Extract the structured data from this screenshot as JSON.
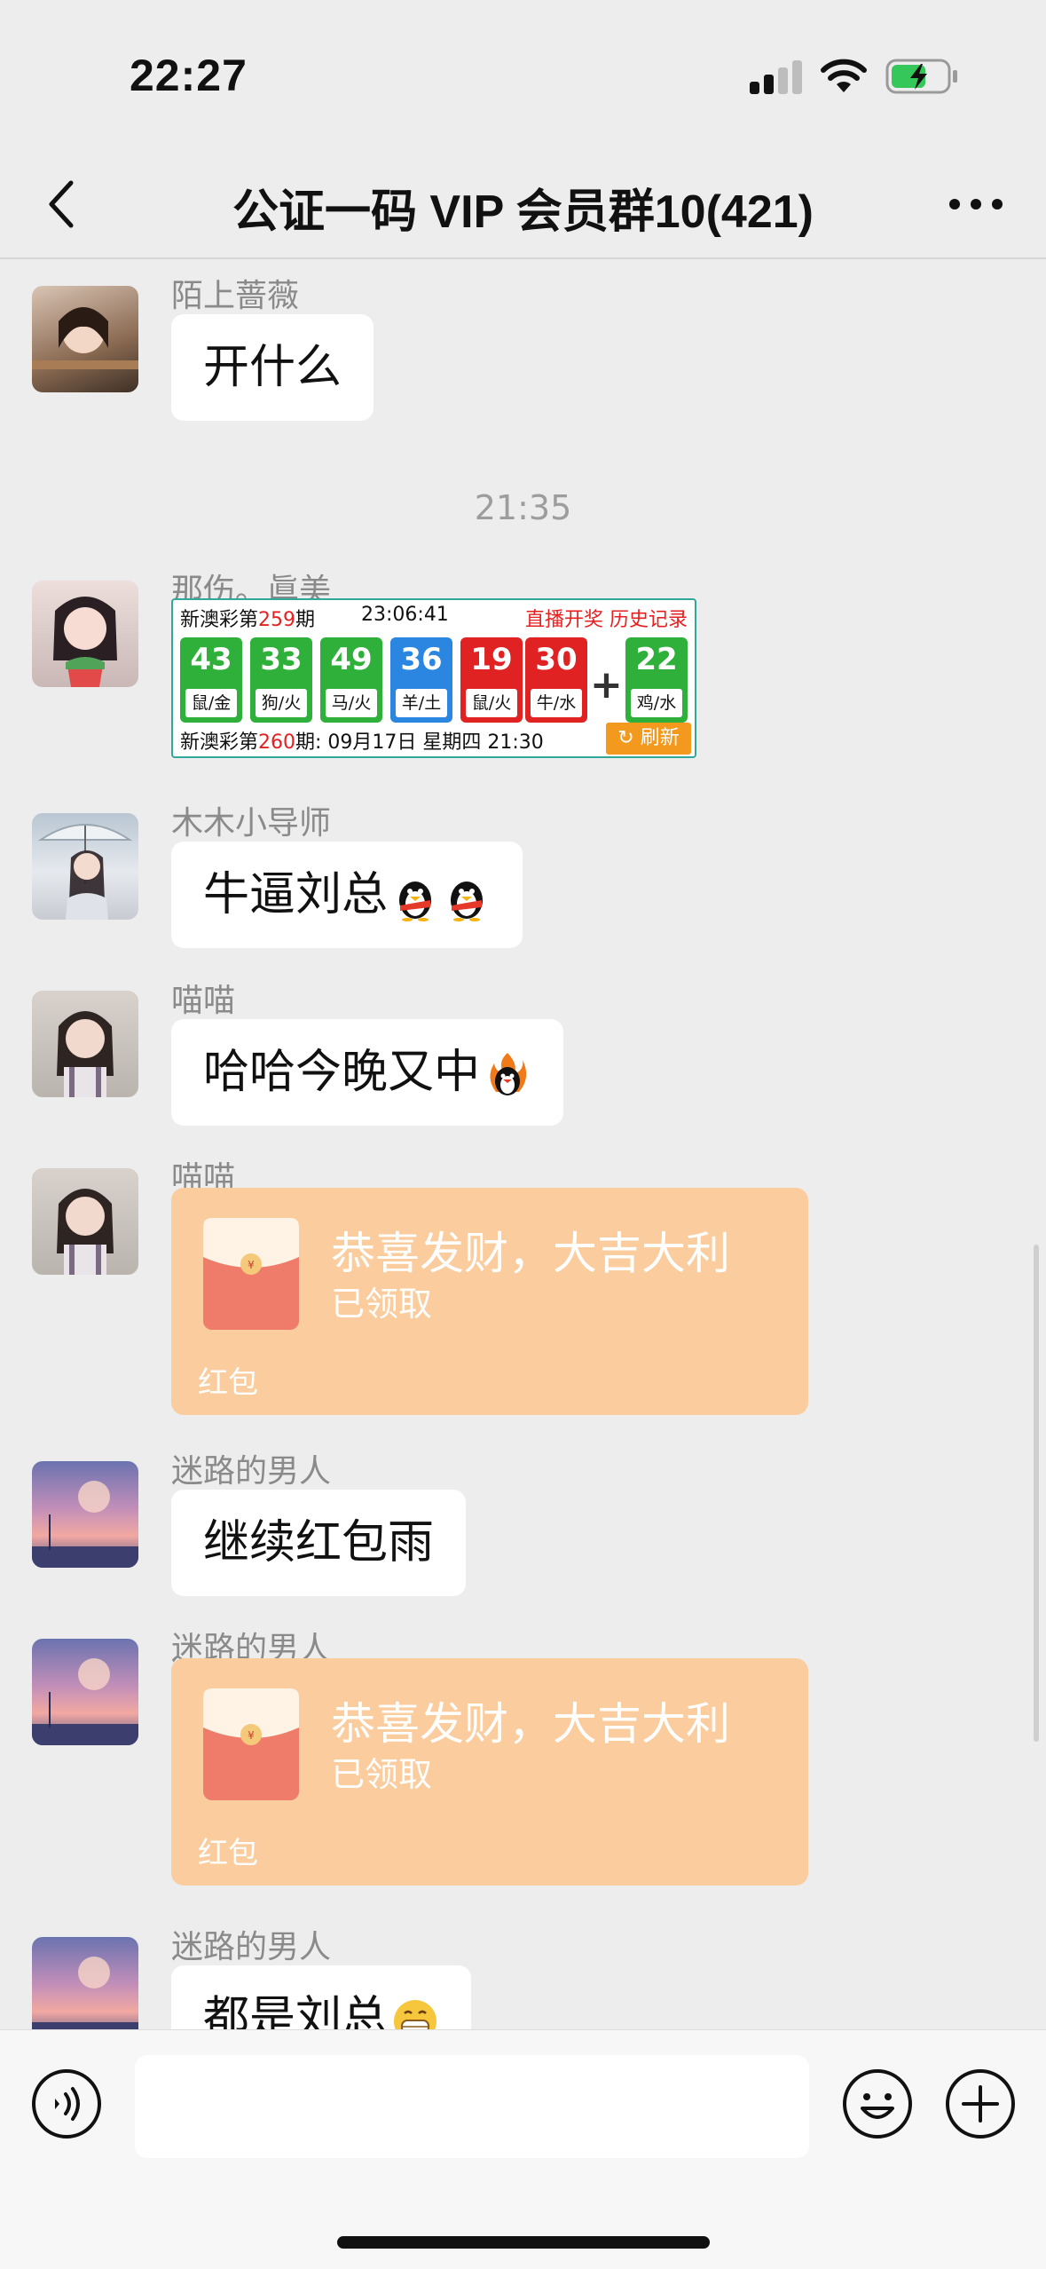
{
  "status_bar": {
    "time": "22:27"
  },
  "nav": {
    "title": "公证一码 VIP 会员群10(421)"
  },
  "messages": [
    {
      "sender": "陌上蔷薇",
      "text": "开什么"
    },
    {
      "timestamp": "21:35"
    },
    {
      "sender": "那伤。眞美",
      "lottery": {
        "header_prefix": "新澳彩第",
        "header_issue": "259",
        "header_suffix": "期",
        "time": "23:06:41",
        "links": "直播开奖  历史记录",
        "balls": [
          {
            "num": "43",
            "tag": "鼠/金",
            "color": "green"
          },
          {
            "num": "33",
            "tag": "狗/火",
            "color": "green"
          },
          {
            "num": "49",
            "tag": "马/火",
            "color": "green"
          },
          {
            "num": "36",
            "tag": "羊/土",
            "color": "blue"
          },
          {
            "num": "19",
            "tag": "鼠/火",
            "color": "red"
          },
          {
            "num": "30",
            "tag": "牛/水",
            "color": "red"
          },
          {
            "num": "22",
            "tag": "鸡/水",
            "color": "green"
          }
        ],
        "plus": "+",
        "footer_prefix": "新澳彩第",
        "footer_issue": "260",
        "footer_suffix": "期: 09月17日 星期四 21:30",
        "refresh": "刷新"
      }
    },
    {
      "sender": "木木小导师",
      "text": "牛逼刘总"
    },
    {
      "sender": "喵喵",
      "text": "哈哈今晚又中"
    },
    {
      "sender": "喵喵",
      "packet": {
        "title": "恭喜发财，大吉大利",
        "status": "已领取",
        "label": "红包"
      }
    },
    {
      "sender": "迷路的男人",
      "text": "继续红包雨"
    },
    {
      "sender": "迷路的男人",
      "packet": {
        "title": "恭喜发财，大吉大利",
        "status": "已领取",
        "label": "红包"
      }
    },
    {
      "sender": "迷路的男人",
      "text": "都是刘总"
    }
  ],
  "colors": {
    "bg": "#ededed",
    "packet": "#fbcc9d",
    "bubble": "#ffffff"
  }
}
